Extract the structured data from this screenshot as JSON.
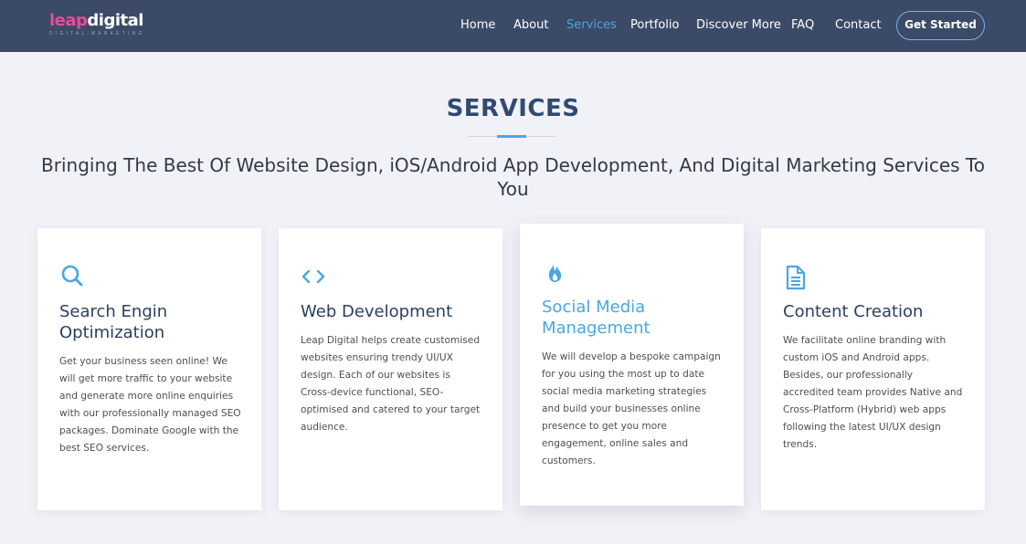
{
  "brand": {
    "logo_part1": "leap",
    "logo_part2": "digital",
    "logo_tagline": "DIGITAL MARKETING"
  },
  "nav": {
    "items": [
      {
        "label": "Home",
        "active": false
      },
      {
        "label": "About",
        "active": false
      },
      {
        "label": "Services",
        "active": true
      },
      {
        "label": "Portfolio",
        "active": false
      },
      {
        "label": "Discover More",
        "active": false
      },
      {
        "label": "FAQ",
        "active": false
      },
      {
        "label": "Contact",
        "active": false
      }
    ],
    "cta_label": "Get Started"
  },
  "section": {
    "title": "SERVICES",
    "subtitle": "Bringing The Best Of Website Design, iOS/Android App Development, And Digital Marketing Services To You"
  },
  "cards": [
    {
      "icon": "search-icon",
      "title": "Search Engin Optimization",
      "text": "Get your business seen online! We will get more traffic to your website and generate more online enquiries with our professionally managed SEO packages. Dominate Google with the best SEO services."
    },
    {
      "icon": "code-icon",
      "title": "Web Development",
      "text": "Leap Digital helps create customised websites ensuring trendy UI/UX design. Each of our websites is Cross-device functional, SEO-optimised and catered to your target audience."
    },
    {
      "icon": "fire-icon",
      "title": "Social Media Management",
      "text": "We will develop a bespoke campaign for you using the most up to date social media marketing strategies and build your businesses online presence to get you more engagement, online sales and customers."
    },
    {
      "icon": "document-icon",
      "title": "Content Creation",
      "text": "We facilitate online branding with custom iOS and Android apps. Besides, our professionally accredited team provides Native and Cross-Platform (Hybrid) web apps following the latest UI/UX design trends."
    }
  ],
  "colors": {
    "nav_bg": "#3b4a66",
    "accent": "#4aa7e2",
    "brand_pink": "#e84b97",
    "title_navy": "#304a72",
    "page_bg": "#f1f2f7"
  }
}
